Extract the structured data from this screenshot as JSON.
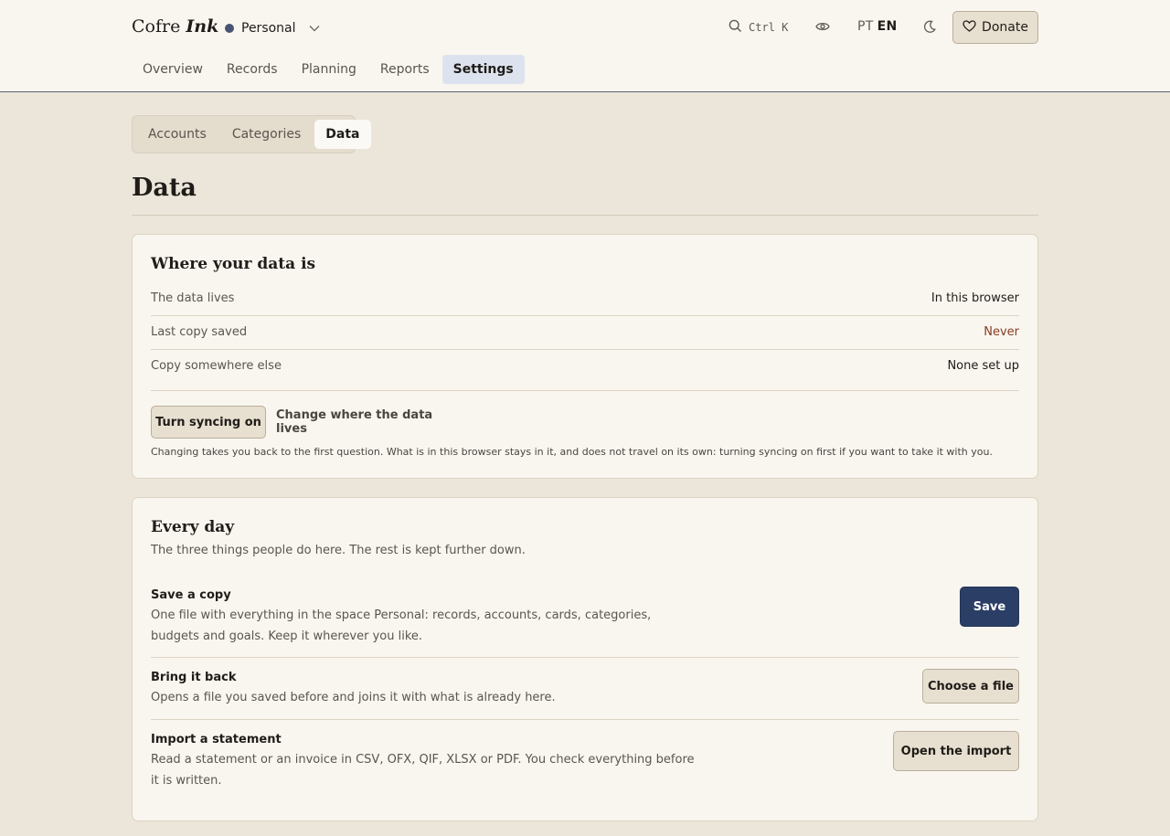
{
  "header": {
    "brand_main": "Cofre",
    "brand_accent": "Ink",
    "space_name": "Personal",
    "search_shortcut": "Ctrl K",
    "lang_pt": "PT",
    "lang_en": "EN",
    "donate_label": "Donate"
  },
  "nav": {
    "items": [
      {
        "label": "Overview"
      },
      {
        "label": "Records"
      },
      {
        "label": "Planning"
      },
      {
        "label": "Reports"
      },
      {
        "label": "Settings"
      }
    ]
  },
  "subtabs": [
    "Accounts",
    "Categories",
    "Data"
  ],
  "page": {
    "title": "Data"
  },
  "where": {
    "title": "Where your data is",
    "rows": [
      {
        "key": "The data lives",
        "value": "In this browser"
      },
      {
        "key": "Last copy saved",
        "value": "Never"
      },
      {
        "key": "Copy somewhere else",
        "value": "None set up"
      }
    ],
    "sync_button": "Turn syncing on",
    "change_button": "Change where the data lives",
    "note": "Changing takes you back to the first question. What is in this browser stays in it, and does not travel on its own: turning syncing on first if you want to take it with you."
  },
  "everyday": {
    "title": "Every day",
    "subtitle": "The three things people do here. The rest is kept further down.",
    "save": {
      "title": "Save a copy",
      "desc": "One file with everything in the space Personal: records, accounts, cards, categories, budgets and goals. Keep it wherever you like.",
      "button": "Save"
    },
    "bring": {
      "title": "Bring it back",
      "desc": "Opens a file you saved before and joins it with what is already here.",
      "button": "Choose a file"
    },
    "import": {
      "title": "Import a statement",
      "desc": "Read a statement or an invoice in CSV, OFX, QIF, XLSX or PDF. You check everything before it is written.",
      "button": "Open the import"
    }
  },
  "colors": {
    "accent": "#2b3e66",
    "warning_text": "#8a3b22",
    "active_tab_bg": "#dde3ee",
    "page_bg": "#ece6da"
  }
}
